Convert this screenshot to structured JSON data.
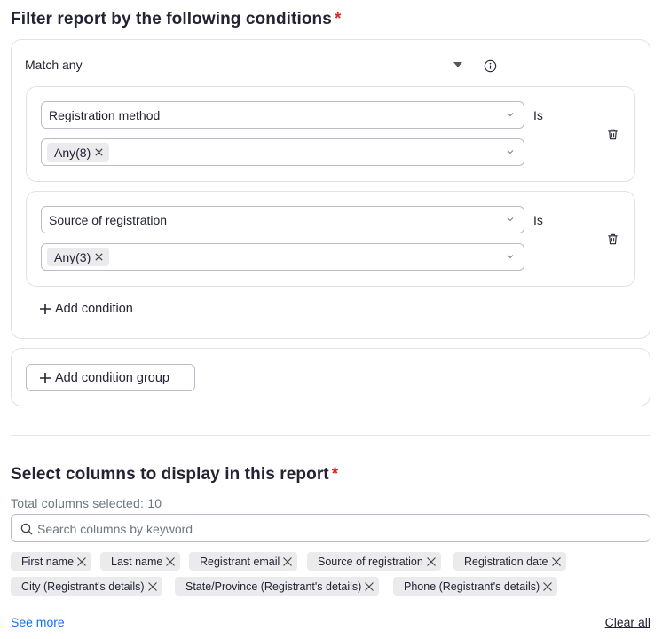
{
  "filter": {
    "title": "Filter report by the following conditions",
    "required_mark": "*",
    "match_label": "Match any",
    "conditions": [
      {
        "field": "Registration method",
        "operator": "Is",
        "value_chip": "Any(8)"
      },
      {
        "field": "Source of registration",
        "operator": "Is",
        "value_chip": "Any(3)"
      }
    ],
    "add_condition_label": "Add condition",
    "add_group_label": "Add condition group"
  },
  "columns": {
    "title": "Select columns to display in this report",
    "required_mark": "*",
    "total_selected": "Total columns selected: 10",
    "search_placeholder": "Search columns by keyword",
    "chips": [
      "First name",
      "Last name",
      "Registrant email",
      "Source of registration",
      "Registration date",
      "City (Registrant's details)",
      "State/Province (Registrant's details)",
      "Phone (Registrant's details)"
    ],
    "see_more": "See more",
    "clear_all": "Clear all"
  },
  "colors": {
    "required": "#e02828",
    "link": "#0e72ed",
    "chip_bg": "#ebebee",
    "border": "#dfe3e8"
  }
}
